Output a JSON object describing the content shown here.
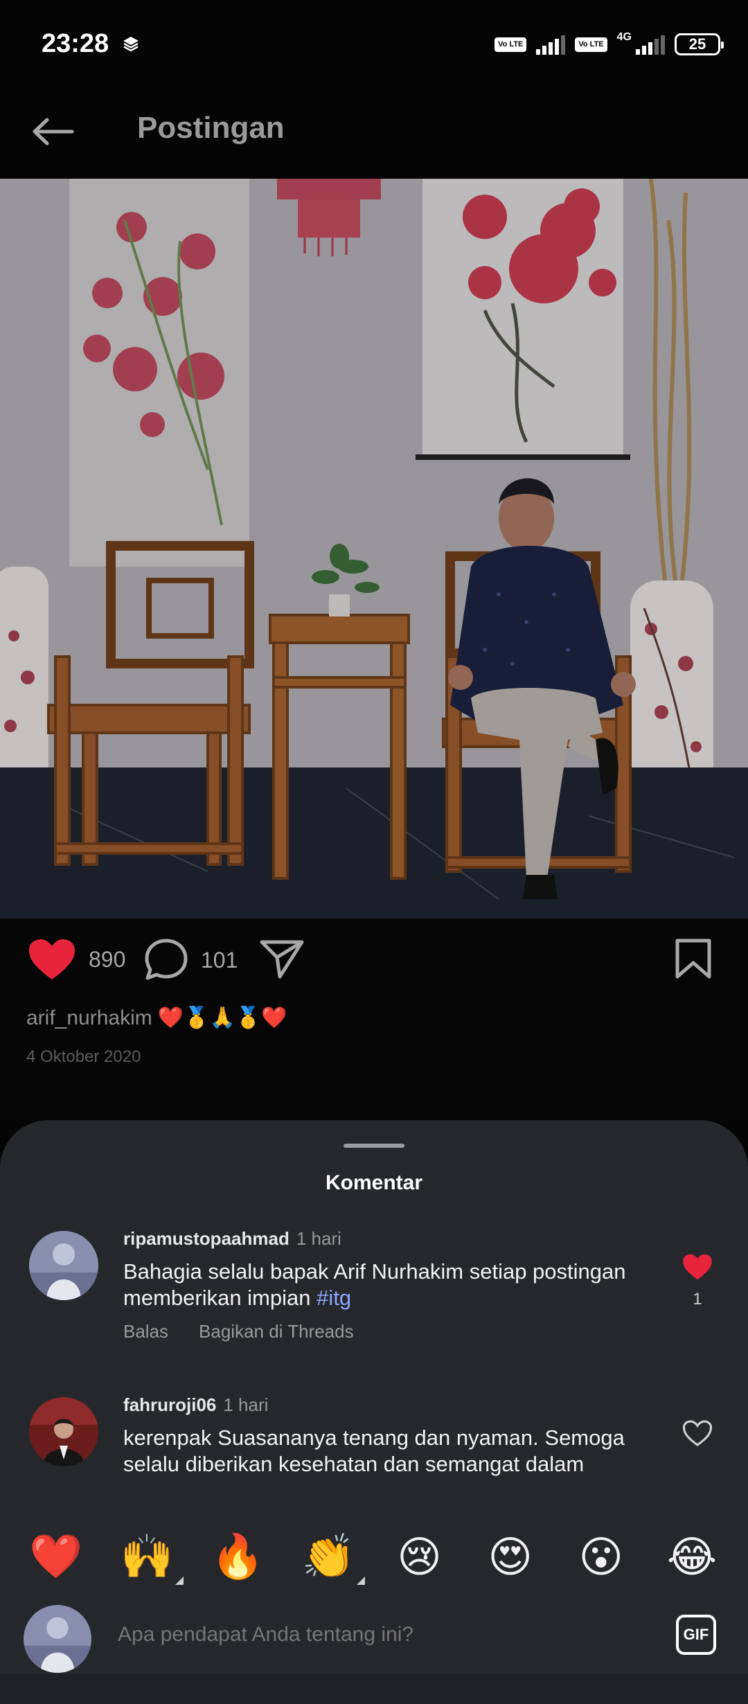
{
  "status_bar": {
    "time": "23:28",
    "volte_1": "Vo LTE",
    "volte_2": "Vo LTE",
    "network": "4G",
    "battery": "25"
  },
  "header": {
    "title": "Postingan",
    "back_icon": "arrow-left-icon"
  },
  "post": {
    "likes": "890",
    "comments": "101",
    "username": "arif_nurhakim",
    "caption_emojis": "❤️🥇🙏🥇❤️",
    "date": "4 Oktober 2020"
  },
  "comments_sheet": {
    "title": "Komentar",
    "comments": [
      {
        "user": "ripamustopaahmad",
        "time": "1 hari",
        "text": "Bahagia selalu bapak Arif Nurhakim setiap postingan memberikan impian ",
        "tag": "#itg",
        "reply": "Balas",
        "share": "Bagikan di Threads",
        "likes": "1"
      },
      {
        "user": "fahruroji06",
        "time": "1 hari",
        "text": "kerenpak Suasananya tenang dan nyaman.  Semoga selalu diberikan kesehatan dan semangat dalam"
      }
    ],
    "emoji_bar": [
      "❤️",
      "🙌",
      "🔥",
      "👏",
      "😢",
      "😍",
      "😮",
      "😂"
    ],
    "input_placeholder": "Apa pendapat Anda tentang ini?",
    "gif_label": "GIF"
  },
  "colors": {
    "like_red": "#e8243c",
    "tag_blue": "#8ea8ff",
    "sheet_bg": "#25272b"
  }
}
